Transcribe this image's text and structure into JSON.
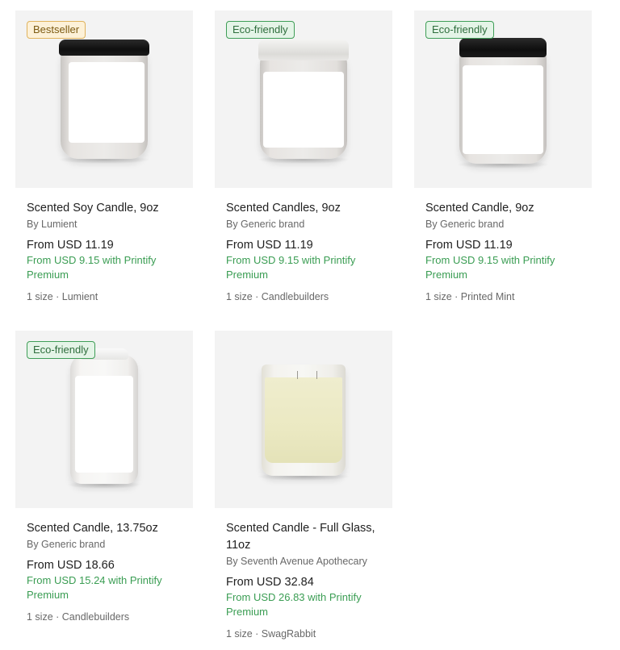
{
  "products": [
    {
      "badge": "Bestseller",
      "title": "Scented Soy Candle, 9oz",
      "brand": "By Lumient",
      "price": "From USD 11.19",
      "premium": "From USD 9.15 with Printify Premium",
      "meta": "1 size · Lumient"
    },
    {
      "badge": "Eco-friendly",
      "title": "Scented Candles, 9oz",
      "brand": "By Generic brand",
      "price": "From USD 11.19",
      "premium": "From USD 9.15 with Printify Premium",
      "meta": "1 size · Candlebuilders"
    },
    {
      "badge": "Eco-friendly",
      "title": "Scented Candle, 9oz",
      "brand": "By Generic brand",
      "price": "From USD 11.19",
      "premium": "From USD 9.15 with Printify Premium",
      "meta": "1 size · Printed Mint"
    },
    {
      "badge": "Eco-friendly",
      "title": "Scented Candle, 13.75oz",
      "brand": "By Generic brand",
      "price": "From USD 18.66",
      "premium": "From USD 15.24 with Printify Premium",
      "meta": "1 size · Candlebuilders"
    },
    {
      "title": "Scented Candle - Full Glass, 11oz",
      "brand": "By Seventh Avenue Apothecary",
      "price": "From USD 32.84",
      "premium": "From USD 26.83 with Printify Premium",
      "meta": "1 size · SwagRabbit"
    }
  ]
}
